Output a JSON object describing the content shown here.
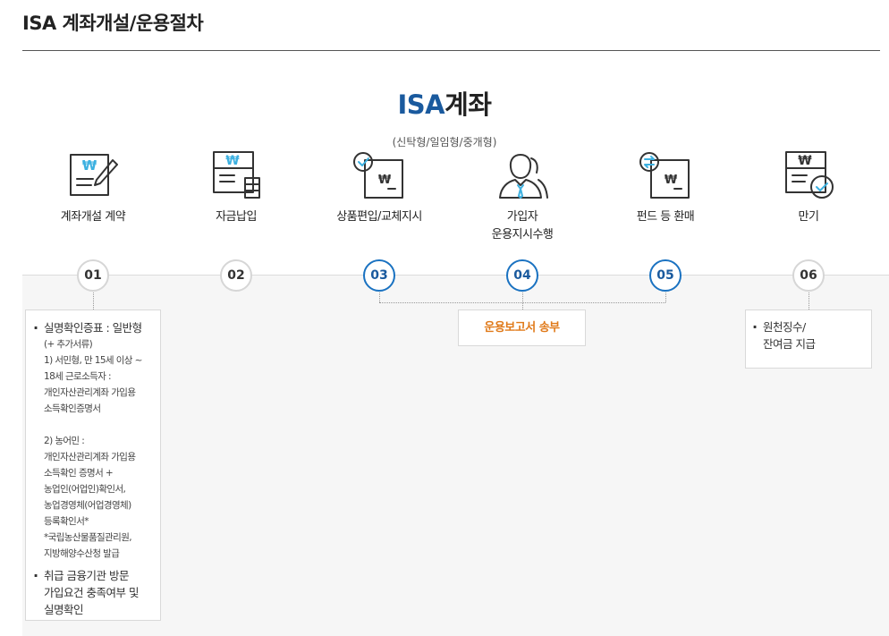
{
  "page": {
    "title": "ISA 계좌개설/운용절차"
  },
  "heading": {
    "accent": "ISA",
    "rest": "계좌",
    "sub": "(신탁형/일임형/중개형)"
  },
  "colors": {
    "accent_blue": "#1a5a9e",
    "circle_active": "#1a72c1",
    "report_orange": "#e07a1a",
    "icon_teal": "#3cb0e0"
  },
  "steps": [
    {
      "num": "01",
      "label": "계좌개설 계약",
      "icon": "contract-pen-icon",
      "active": false
    },
    {
      "num": "02",
      "label": "자금납입",
      "icon": "deposit-coins-icon",
      "active": false
    },
    {
      "num": "03",
      "label": "상품편입/교체지시",
      "icon": "product-check-icon",
      "active": true
    },
    {
      "num": "04",
      "label": "가입자\n운용지시수행",
      "icon": "subscriber-people-icon",
      "active": true
    },
    {
      "num": "05",
      "label": "펀드 등 환매",
      "icon": "fund-exchange-icon",
      "active": true
    },
    {
      "num": "06",
      "label": "만기",
      "icon": "maturity-check-icon",
      "active": false
    }
  ],
  "report": {
    "label": "운용보고서 송부"
  },
  "step1_notes": {
    "item1_main": "실명확인증표 : 일반형",
    "item1_detail": "(+ 추가서류)\n1) 서민형, 만 15세 이상 ~\n18세 근로소득자 :\n개인자산관리계좌 가입용\n소득확인증명서\n\n2) 농어민 :\n개인자산관리계좌 가입용\n소득확인 증명서 +\n농업인(어업인)확인서,\n농업경영체(어업경영체)\n등록확인서*\n*국립농산물품질관리원,\n지방해양수산청 발급",
    "item2": "취급 금융기관 방문\n가입요건 충족여부 및\n실명확인"
  },
  "step6_notes": {
    "item1": "원천징수/\n잔여금 지급"
  }
}
